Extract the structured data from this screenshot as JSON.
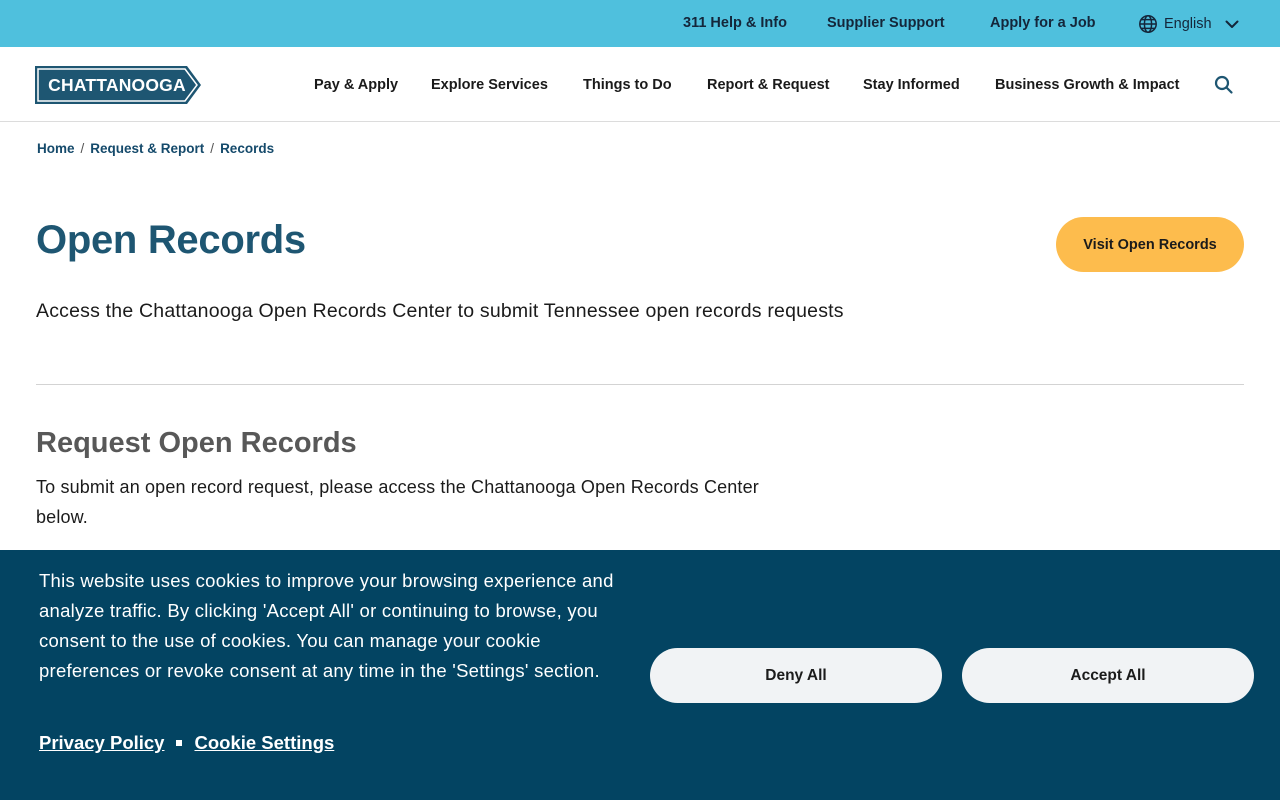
{
  "utility": {
    "help": "311 Help & Info",
    "supplier": "Supplier Support",
    "job": "Apply for a Job",
    "language": "English"
  },
  "logo": {
    "text": "CHATTANOOGA"
  },
  "nav": {
    "pay": "Pay & Apply",
    "explore": "Explore Services",
    "things": "Things to Do",
    "report": "Report & Request",
    "informed": "Stay Informed",
    "business": "Business Growth & Impact"
  },
  "breadcrumb": {
    "home": "Home",
    "parent": "Request & Report",
    "current": "Records",
    "separator": "/"
  },
  "page": {
    "title": "Open Records",
    "cta": "Visit Open Records",
    "lede": "Access the Chattanooga Open Records Center to submit Tennessee open records requests"
  },
  "section": {
    "title": "Request Open Records",
    "body": "To submit an open record request, please access the Chattanooga Open Records Center below."
  },
  "cookie": {
    "text": "This website uses cookies to improve your browsing experience and analyze traffic. By clicking 'Accept All' or continuing to browse, you consent to the use of cookies. You can manage your cookie preferences or revoke consent at any time in the 'Settings' section.",
    "privacy": "Privacy Policy",
    "settings": "Cookie Settings",
    "deny": "Deny All",
    "accept": "Accept All"
  },
  "colors": {
    "utility_bg": "#4fc0dd",
    "brand_blue": "#1e5672",
    "cta_yellow": "#fdbc4d",
    "cookie_bg": "#034462"
  },
  "icons": {
    "language": "globe-icon",
    "language_toggle": "chevron-down-icon",
    "search": "search-icon"
  }
}
